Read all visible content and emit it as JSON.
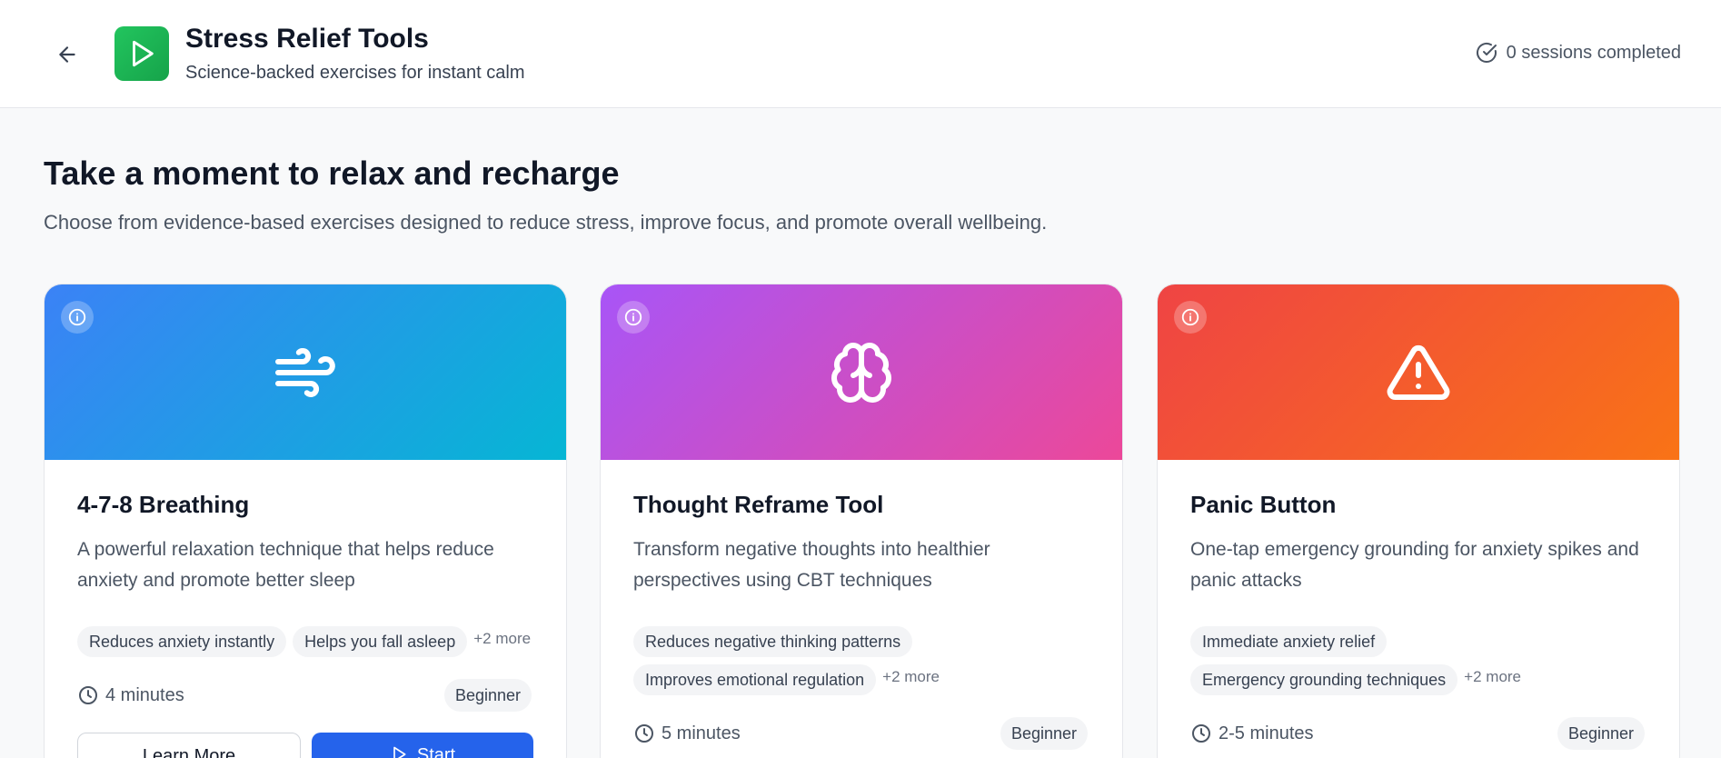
{
  "header": {
    "title": "Stress Relief Tools",
    "subtitle": "Science-backed exercises for instant calm",
    "sessions": "0 sessions completed"
  },
  "hero": {
    "heading": "Take a moment to relax and recharge",
    "description": "Choose from evidence-based exercises designed to reduce stress, improve focus, and promote overall wellbeing."
  },
  "cards": [
    {
      "icon": "wind-icon",
      "gradient": [
        "#3b82f6",
        "#06b6d4"
      ],
      "title": "4-7-8 Breathing",
      "description": "A powerful relaxation technique that helps reduce anxiety and promote better sleep",
      "tags": [
        "Reduces anxiety instantly",
        "Helps you fall asleep"
      ],
      "more": "+2 more",
      "duration": "4 minutes",
      "level": "Beginner",
      "learn_label": "Learn More",
      "start_label": "Start"
    },
    {
      "icon": "brain-icon",
      "gradient": [
        "#a855f7",
        "#ec4899"
      ],
      "title": "Thought Reframe Tool",
      "description": "Transform negative thoughts into healthier perspectives using CBT techniques",
      "tags": [
        "Reduces negative thinking patterns",
        "Improves emotional regulation"
      ],
      "more": "+2 more",
      "duration": "5 minutes",
      "level": "Beginner"
    },
    {
      "icon": "alert-triangle-icon",
      "gradient": [
        "#ef4444",
        "#f97316"
      ],
      "title": "Panic Button",
      "description": "One-tap emergency grounding for anxiety spikes and panic attacks",
      "tags": [
        "Immediate anxiety relief",
        "Emergency grounding techniques"
      ],
      "more": "+2 more",
      "duration": "2-5 minutes",
      "level": "Beginner"
    }
  ]
}
